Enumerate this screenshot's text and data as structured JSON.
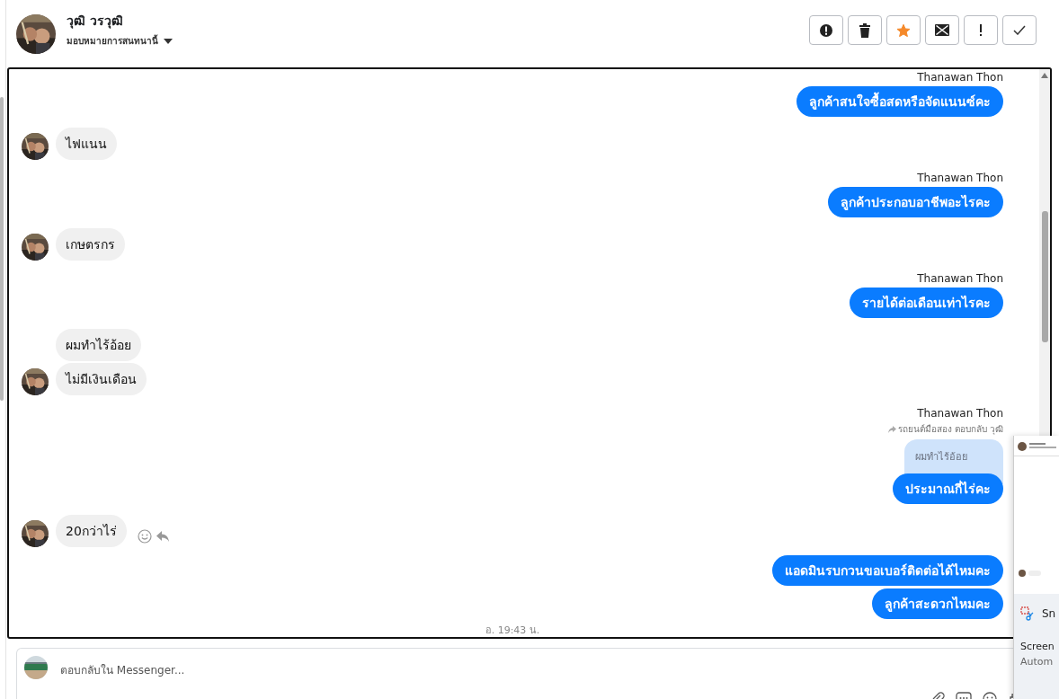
{
  "header": {
    "name": "วุฒิ วรวุฒิ",
    "assign_label": "มอบหมายการสนทนานี้",
    "starred": true
  },
  "messages": [
    {
      "kind": "outgoing",
      "sender": "Thanawan Thon",
      "text": "ลูกค้าสนใจซื้อสดหรือจัดแนนซ์คะ"
    },
    {
      "kind": "incoming",
      "avatar": true,
      "text": "ไฟแนน"
    },
    {
      "kind": "outgoing",
      "sender": "Thanawan Thon",
      "text": "ลูกค้าประกอบอาชีพอะไรคะ"
    },
    {
      "kind": "incoming",
      "avatar": true,
      "text": "เกษตรกร"
    },
    {
      "kind": "outgoing",
      "sender": "Thanawan Thon",
      "text": "รายได้ต่อเดือนเท่าไรคะ"
    },
    {
      "kind": "incoming",
      "avatar": false,
      "text": "ผมทำไร้อ้อย"
    },
    {
      "kind": "incoming",
      "avatar": true,
      "text": "ไม่มีเงินเดือน"
    },
    {
      "kind": "outgoing",
      "sender": "Thanawan Thon",
      "reply_note": "รถยนต์มือสอง ตอบกลับ วุฒิ",
      "quote": "ผมทำไร้อ้อย",
      "text": "ประมาณกี่ไร่คะ"
    },
    {
      "kind": "incoming",
      "avatar": true,
      "actions": true,
      "text": "20กว่าไร่"
    },
    {
      "kind": "outgoing",
      "text": "แอดมินรบกวนขอเบอร์ติดต่อได้ไหมคะ"
    },
    {
      "kind": "outgoing",
      "text": "ลูกค้าสะดวกไหมคะ"
    }
  ],
  "timestamp": "อ. 19:43 น.",
  "composer": {
    "placeholder": "ตอบกลับใน Messenger..."
  },
  "snip_popup": {
    "title": "Sn",
    "line_1": "Screen",
    "line_2": "Autom"
  }
}
